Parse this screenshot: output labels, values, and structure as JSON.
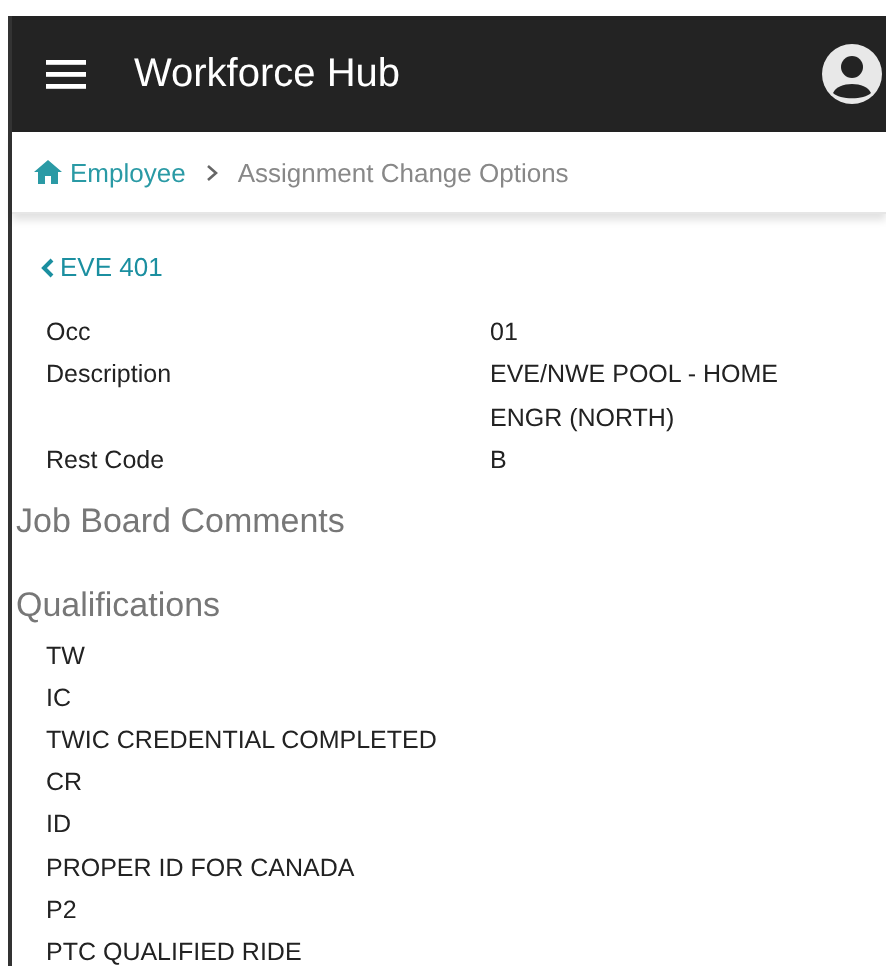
{
  "app_bar": {
    "title": "Workforce Hub"
  },
  "breadcrumb": [
    {
      "label": "Employee",
      "kind": "link"
    },
    {
      "label": "Assignment Change Options",
      "kind": "current"
    }
  ],
  "back_link": {
    "label": "EVE 401"
  },
  "details": [
    {
      "label": "Occ",
      "value": "01"
    },
    {
      "label": "Description",
      "value": "EVE/NWE POOL - HOME ENGR (NORTH)"
    },
    {
      "label": "Rest Code",
      "value": "B"
    }
  ],
  "sections": [
    {
      "title": "Job Board Comments"
    },
    {
      "title": "Qualifications",
      "items": [
        "TW",
        "IC",
        "TWIC CREDENTIAL COMPLETED",
        "CR",
        "ID",
        "PROPER ID FOR CANADA",
        "P2",
        "PTC QUALIFIED RIDE"
      ]
    }
  ]
}
